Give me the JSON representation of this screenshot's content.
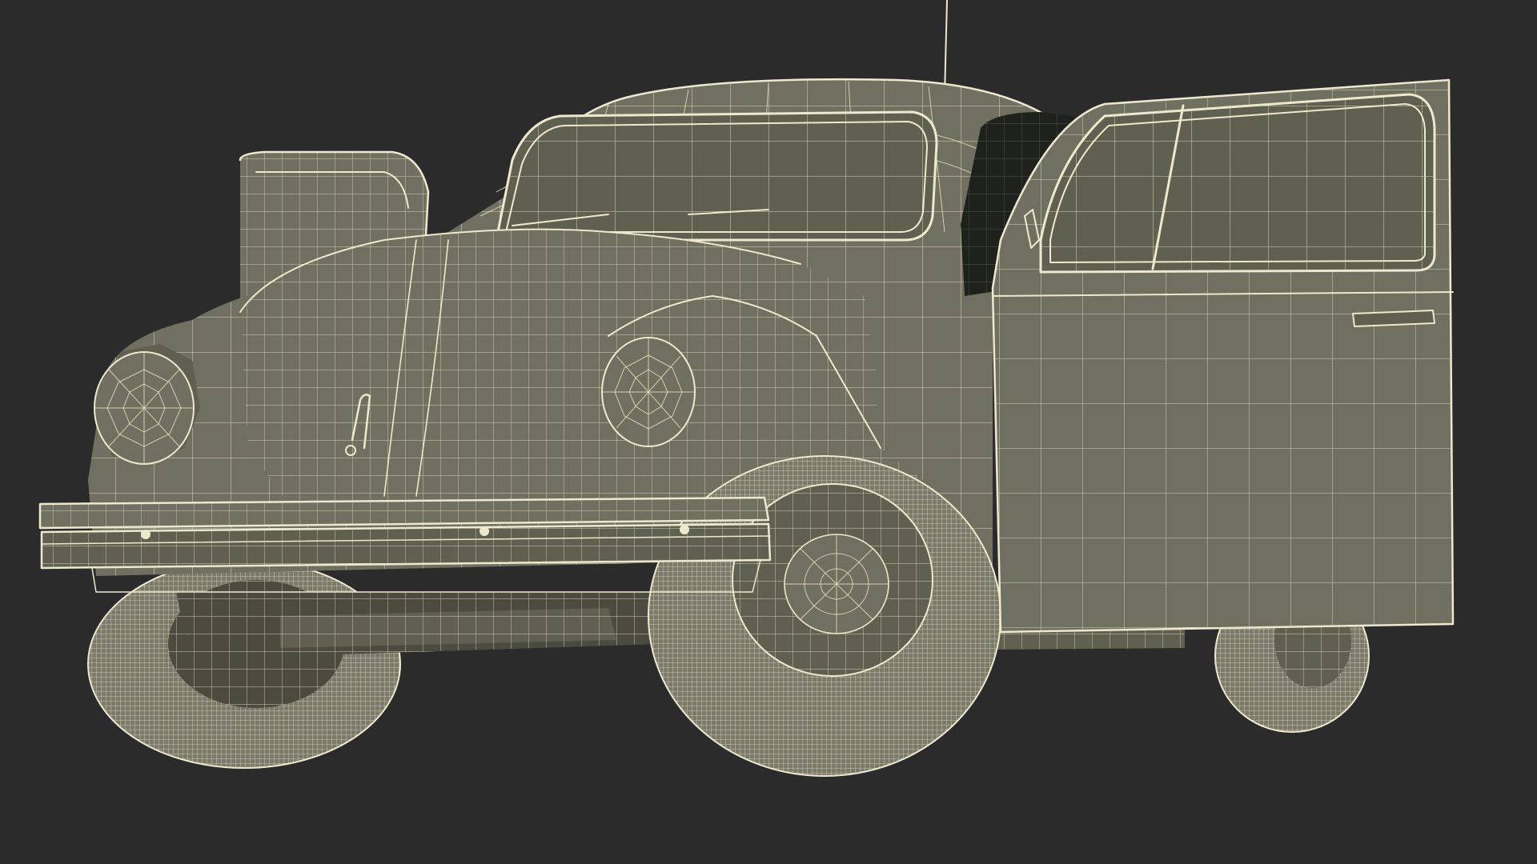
{
  "scene": {
    "background_color": "#2b2b2b",
    "model_fill_color": "#6f705f",
    "wire_color": "#ece9cf",
    "subject": "vintage-beetle-car-wireframe-render"
  }
}
